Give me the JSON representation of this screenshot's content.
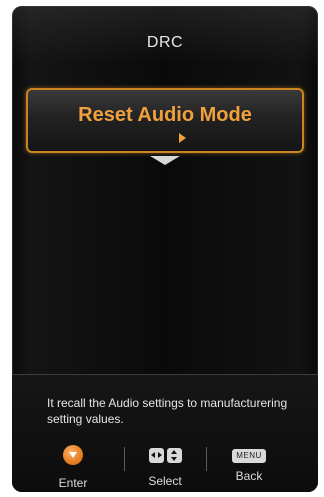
{
  "screen": {
    "title": "DRC"
  },
  "menu": {
    "selected_item": {
      "label": "Reset Audio Mode"
    }
  },
  "icons": {
    "submenu_arrow": "arrow-right-icon",
    "scroll": "chevron-down-icon"
  },
  "footer": {
    "help_text": "It recall the Audio settings to manufacturering setting values.",
    "keys": {
      "enter": {
        "label": "Enter",
        "icon": "enter-button-icon"
      },
      "select": {
        "label": "Select",
        "icon": "dpad-icon"
      },
      "back": {
        "label": "Back",
        "key_text": "MENU"
      }
    }
  },
  "colors": {
    "accent": "#f0a03c",
    "highlight_border": "#c9861f",
    "background": "#0a0a0a",
    "text": "#e8e8e8"
  }
}
